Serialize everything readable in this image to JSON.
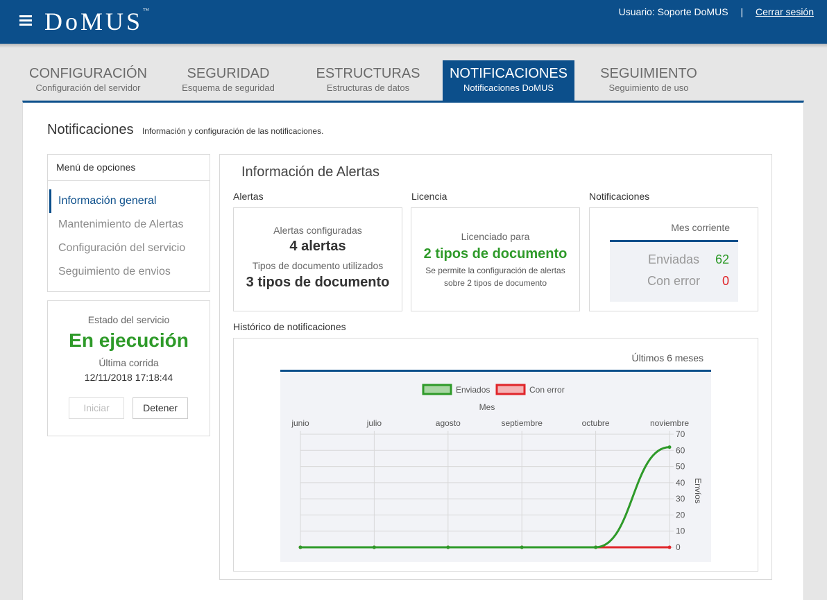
{
  "header": {
    "logo": "DoMUS",
    "logo_tm": "™",
    "user_label": "Usuario: Soporte DoMUS",
    "separator": "|",
    "logout": "Cerrar sesión"
  },
  "tabs": [
    {
      "title": "CONFIGURACIÓN",
      "subtitle": "Configuración del servidor"
    },
    {
      "title": "SEGURIDAD",
      "subtitle": "Esquema de seguridad"
    },
    {
      "title": "ESTRUCTURAS",
      "subtitle": "Estructuras de datos"
    },
    {
      "title": "NOTIFICACIONES",
      "subtitle": "Notificaciones DoMUS"
    },
    {
      "title": "SEGUIMIENTO",
      "subtitle": "Seguimiento de uso"
    }
  ],
  "page": {
    "title": "Notificaciones",
    "subtitle": "Información y configuración de las notificaciones."
  },
  "menu": {
    "header": "Menú de opciones",
    "items": [
      {
        "label": "Información general"
      },
      {
        "label": "Mantenimiento de Alertas"
      },
      {
        "label": "Configuración del servicio"
      },
      {
        "label": "Seguimiento de envios"
      }
    ]
  },
  "service": {
    "label": "Estado del servicio",
    "state": "En ejecución",
    "last_run_label": "Última corrida",
    "last_run": "12/11/2018 17:18:44",
    "start_label": "Iniciar",
    "stop_label": "Detener"
  },
  "info": {
    "title": "Información de Alertas",
    "alerts": {
      "section": "Alertas",
      "configured_label": "Alertas configuradas",
      "configured_value": "4 alertas",
      "doc_types_label": "Tipos de documento utilizados",
      "doc_types_value": "3 tipos de documento"
    },
    "license": {
      "section": "Licencia",
      "label": "Licenciado para",
      "value": "2 tipos de documento",
      "note_line1": "Se permite la configuración de alertas",
      "note_line2": "sobre 2 tipos de documento"
    },
    "notifications": {
      "section": "Notificaciones",
      "period": "Mes corriente",
      "sent_label": "Enviadas",
      "sent_value": "62",
      "error_label": "Con error",
      "error_value": "0"
    },
    "history": {
      "section": "Histórico de notificaciones",
      "period": "Últimos 6 meses"
    }
  },
  "colors": {
    "brand": "#0c4f8b",
    "green": "#2e9a29",
    "red": "#e0262b"
  },
  "chart_data": {
    "type": "line",
    "xlabel": "Mes",
    "ylabel": "Envíos",
    "categories": [
      "junio",
      "julio",
      "agosto",
      "septiembre",
      "octubre",
      "noviembre"
    ],
    "yticks": [
      0,
      10,
      20,
      30,
      40,
      50,
      60,
      70
    ],
    "ylim": [
      0,
      70
    ],
    "series": [
      {
        "name": "Enviados",
        "values": [
          0,
          0,
          0,
          0,
          0,
          62
        ],
        "color": "#2e9a29"
      },
      {
        "name": "Con error",
        "values": [
          0,
          0,
          0,
          0,
          0,
          0
        ],
        "color": "#e0262b"
      }
    ],
    "legend": "top",
    "grid": true
  }
}
